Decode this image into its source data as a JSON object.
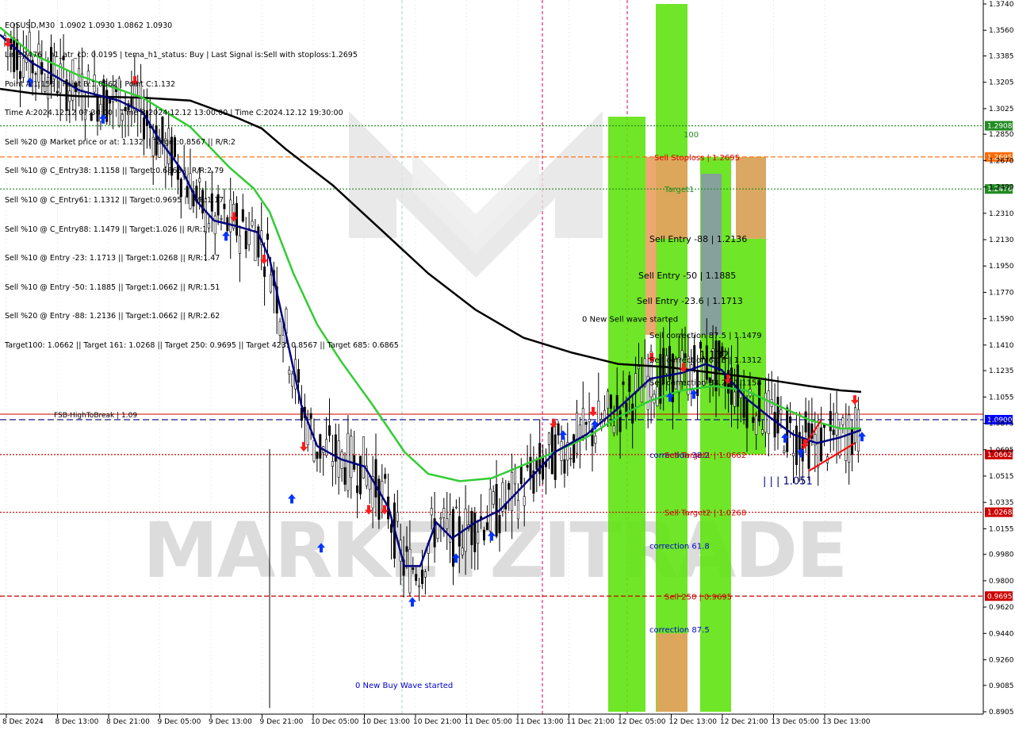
{
  "header": {
    "lines": [
      "EOSUSD,M30  1.0902 1.0930 1.0862 1.0930",
      "Line:1476 | h1_atr_c0: 0.0195 | tema_h1_status: Buy | Last Signal is:Sell with stoploss:1.2695",
      "Point A:1.156 | Point B:1.0662 | Point C:1.132",
      "Time A:2024.12.12 07:30:00 | Time B:2024.12.12 13:00:00 | Time C:2024.12.12 19:30:00",
      "Sell %20 @ Market price or at: 1.132 || Target:0.8567 || R/R:2",
      "Sell %10 @ C_Entry38: 1.1158 || Target:0.6865 || R/R:2.79",
      "Sell %10 @ C_Entry61: 1.1312 || Target:0.9695 || R/R:1.17",
      "Sell %10 @ C_Entry88: 1.1479 || Target:1.026 || R/R:1",
      "Sell %10 @ Entry -23: 1.1713 || Target:1.0268 || R/R:1.47",
      "Sell %10 @ Entry -50: 1.1885 || Target:1.0662 || R/R:1.51",
      "Sell %20 @ Entry -88: 1.2136 || Target:1.0662 || R/R:2.62",
      "Target100: 1.0662 || Target 161: 1.0268 || Target 250: 0.9695 || Target 423: 0.8567 || Target 685: 0.6865"
    ]
  },
  "chart_data": {
    "type": "candlestick",
    "symbol": "EOSUSD",
    "timeframe": "M30",
    "ylim": [
      0.8905,
      1.374
    ],
    "y_ticks": [
      "1.3740",
      "1.3560",
      "1.3385",
      "1.3205",
      "1.3025",
      "1.2850",
      "1.2670",
      "1.2490",
      "1.2310",
      "1.2130",
      "1.1950",
      "1.1770",
      "1.1590",
      "1.1410",
      "1.1235",
      "1.1055",
      "1.0875",
      "1.0695",
      "1.0515",
      "1.0335",
      "1.0155",
      "0.9980",
      "0.9800",
      "0.9620",
      "0.9440",
      "0.9260",
      "0.9085",
      "0.8905"
    ],
    "x_ticks": [
      "8 Dec 2024",
      "8 Dec 13:00",
      "8 Dec 21:00",
      "9 Dec 05:00",
      "9 Dec 13:00",
      "9 Dec 21:00",
      "10 Dec 05:00",
      "10 Dec 13:00",
      "10 Dec 21:00",
      "11 Dec 05:00",
      "11 Dec 13:00",
      "11 Dec 21:00",
      "12 Dec 05:00",
      "12 Dec 13:00",
      "12 Dec 21:00",
      "13 Dec 05:00",
      "13 Dec 13:00"
    ],
    "price_lines": [
      {
        "value": 1.2908,
        "label": "1.2908",
        "color": "#228b22",
        "style": "dotted"
      },
      {
        "value": 1.2695,
        "label": "1.2695",
        "color": "#ff6a00",
        "style": "dashed"
      },
      {
        "value": 1.2476,
        "label": "1.2476",
        "color": "#228b22",
        "style": "dotted"
      },
      {
        "value": 1.0662,
        "label": "1.0662",
        "color": "#cc0000",
        "style": "dotted"
      },
      {
        "value": 1.0268,
        "label": "1.0268",
        "color": "#cc0000",
        "style": "dotted"
      },
      {
        "value": 0.9695,
        "label": "0.9695",
        "color": "#cc0000",
        "style": "dashed"
      }
    ],
    "current_price": {
      "value": 1.09,
      "label": "1.0900",
      "color": "#0000ff"
    },
    "fsb_line": {
      "value": 1.09,
      "label": "FSB-HighToBreak | 1.09",
      "color": "#000080"
    },
    "ma_black": [
      [
        0,
        1.316
      ],
      [
        40,
        1.313
      ],
      [
        100,
        1.311
      ],
      [
        180,
        1.31
      ],
      [
        240,
        1.308
      ],
      [
        300,
        1.296
      ],
      [
        330,
        1.289
      ],
      [
        360,
        1.275
      ],
      [
        420,
        1.25
      ],
      [
        480,
        1.22
      ],
      [
        540,
        1.19
      ],
      [
        600,
        1.165
      ],
      [
        660,
        1.146
      ],
      [
        720,
        1.136
      ],
      [
        780,
        1.128
      ],
      [
        840,
        1.126
      ],
      [
        900,
        1.122
      ],
      [
        960,
        1.118
      ],
      [
        1020,
        1.113
      ],
      [
        1060,
        1.11
      ],
      [
        1086,
        1.109
      ]
    ],
    "ma_green": [
      [
        0,
        1.358
      ],
      [
        40,
        1.34
      ],
      [
        100,
        1.325
      ],
      [
        180,
        1.31
      ],
      [
        240,
        1.29
      ],
      [
        290,
        1.262
      ],
      [
        320,
        1.248
      ],
      [
        340,
        1.232
      ],
      [
        370,
        1.19
      ],
      [
        400,
        1.155
      ],
      [
        430,
        1.13
      ],
      [
        470,
        1.1
      ],
      [
        510,
        1.068
      ],
      [
        540,
        1.053
      ],
      [
        580,
        1.048
      ],
      [
        620,
        1.05
      ],
      [
        660,
        1.059
      ],
      [
        700,
        1.068
      ],
      [
        740,
        1.078
      ],
      [
        780,
        1.092
      ],
      [
        820,
        1.103
      ],
      [
        860,
        1.11
      ],
      [
        900,
        1.113
      ],
      [
        940,
        1.11
      ],
      [
        980,
        1.1
      ],
      [
        1020,
        1.09
      ],
      [
        1060,
        1.084
      ],
      [
        1086,
        1.084
      ]
    ],
    "ma_navy": [
      [
        0,
        1.353
      ],
      [
        40,
        1.334
      ],
      [
        100,
        1.315
      ],
      [
        150,
        1.308
      ],
      [
        180,
        1.3
      ],
      [
        200,
        1.282
      ],
      [
        230,
        1.26
      ],
      [
        250,
        1.238
      ],
      [
        270,
        1.226
      ],
      [
        300,
        1.222
      ],
      [
        325,
        1.218
      ],
      [
        340,
        1.2
      ],
      [
        360,
        1.15
      ],
      [
        380,
        1.1
      ],
      [
        400,
        1.072
      ],
      [
        430,
        1.063
      ],
      [
        460,
        1.058
      ],
      [
        490,
        1.03
      ],
      [
        510,
        0.99
      ],
      [
        530,
        0.99
      ],
      [
        550,
        1.02
      ],
      [
        570,
        1.009
      ],
      [
        600,
        1.02
      ],
      [
        630,
        1.028
      ],
      [
        660,
        1.045
      ],
      [
        700,
        1.068
      ],
      [
        740,
        1.08
      ],
      [
        780,
        1.098
      ],
      [
        820,
        1.118
      ],
      [
        860,
        1.122
      ],
      [
        890,
        1.128
      ],
      [
        910,
        1.124
      ],
      [
        940,
        1.105
      ],
      [
        970,
        1.092
      ],
      [
        1000,
        1.08
      ],
      [
        1030,
        1.074
      ],
      [
        1060,
        1.078
      ],
      [
        1086,
        1.083
      ]
    ],
    "zones": [
      {
        "color": "#5fe30f",
        "from": 0.8905,
        "to": 1.297,
        "x": [
          767,
          814
        ]
      },
      {
        "color": "#5fe30f",
        "from": 0.8905,
        "to": 1.374,
        "x": [
          827,
          867
        ]
      },
      {
        "color": "#5fe30f",
        "from": 0.8905,
        "to": 1.2695,
        "x": [
          883,
          922
        ]
      },
      {
        "color": "#5fe30f",
        "from": 1.0662,
        "to": 1.2136,
        "x": [
          922,
          966
        ]
      },
      {
        "color": "#e8a060",
        "from": 1.2136,
        "to": 1.2695,
        "x": [
          814,
          867
        ]
      },
      {
        "color": "#e8a060",
        "from": 1.1479,
        "to": 1.2136,
        "x": [
          814,
          828
        ]
      },
      {
        "color": "#d69e52",
        "from": 1.2136,
        "to": 1.2695,
        "x": [
          928,
          966
        ]
      },
      {
        "color": "#e8a060",
        "from": 0.8905,
        "to": 0.944,
        "x": [
          828,
          867
        ]
      },
      {
        "color": "#8899aa",
        "from": 1.1479,
        "to": 1.258,
        "x": [
          884,
          910
        ]
      }
    ],
    "levels": [
      {
        "text": "Sell Stoploss | 1.2695",
        "value": 1.2695,
        "color": "#cc0000"
      },
      {
        "text": "Target1",
        "value": 1.2476,
        "color": "#228b22"
      },
      {
        "text": "Sell Entry -88 | 1.2136",
        "value": 1.2136,
        "color": "#000000"
      },
      {
        "text": "Sell Entry -50 | 1.1885",
        "value": 1.1885,
        "color": "#000000"
      },
      {
        "text": "Sell Entry -23.6 | 1.1713",
        "value": 1.1713,
        "color": "#000000"
      },
      {
        "text": "Sell correction 87.5 | 1.1479",
        "value": 1.1479,
        "color": "#000000"
      },
      {
        "text": "Sell correction 61.8 | 1.1312",
        "value": 1.1312,
        "color": "#000000"
      },
      {
        "text": "Sell correction 38.2 | 1.1158",
        "value": 1.1158,
        "color": "#000000"
      },
      {
        "text": "correction 38.2",
        "value": 1.0662,
        "color": "#0000cc"
      },
      {
        "text": "Sell Target1 | 1.0662",
        "value": 1.0662,
        "color": "#cc0000"
      },
      {
        "text": "Sell Target2 | 1.0268",
        "value": 1.0268,
        "color": "#cc0000"
      },
      {
        "text": "correction 61.8",
        "value": 1.004,
        "color": "#0000cc"
      },
      {
        "text": "Sell  250 | 0.9695",
        "value": 0.9695,
        "color": "#cc0000"
      },
      {
        "text": "correction 87.5",
        "value": 0.947,
        "color": "#0000cc"
      }
    ],
    "annotations": [
      {
        "text": "100",
        "value": 1.285,
        "color": "#228b22"
      },
      {
        "text": "0 New Sell wave started",
        "value": 1.159,
        "color": "#000000"
      },
      {
        "text": "1.132",
        "value": 1.134,
        "color": "#000000"
      },
      {
        "text": "| | | 1.051",
        "value": 1.048,
        "color": "#000080"
      },
      {
        "text": "0 New Buy Wave started",
        "value": 0.909,
        "color": "#0000cc"
      }
    ],
    "watermark": "MARKETZITRADE"
  },
  "colors": {
    "background": "#ffffff",
    "grid": "#e6e6e6",
    "axis": "#000000",
    "up_arrow": "#0033ff",
    "down_arrow": "#ff1a1a",
    "candle": "#000000"
  }
}
